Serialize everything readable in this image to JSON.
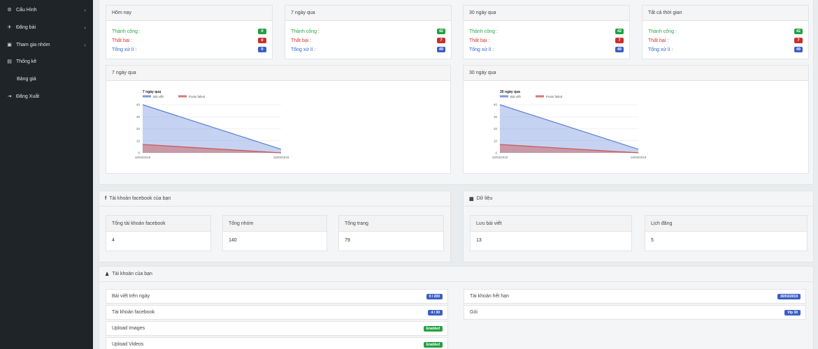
{
  "sidebar": {
    "items": [
      {
        "icon": "gear-icon",
        "label": "Cấu Hình",
        "glyph": "⚙",
        "chevron": "‹"
      },
      {
        "icon": "paper-plane-icon",
        "label": "Đăng bài",
        "glyph": "✈",
        "chevron": "‹"
      },
      {
        "icon": "group-icon",
        "label": "Tham gia nhóm",
        "glyph": "▣",
        "chevron": "‹"
      },
      {
        "icon": "chart-icon",
        "label": "Thống kê",
        "glyph": "▤",
        "chevron": ""
      },
      {
        "icon": "",
        "label": "Bảng giá",
        "glyph": "",
        "chevron": ""
      },
      {
        "icon": "sign-out-icon",
        "label": "Đăng Xuất",
        "glyph": "⇥",
        "chevron": ""
      }
    ]
  },
  "stats": [
    {
      "title": "Hôm nay",
      "success_label": "Thành công :",
      "success": "0",
      "fail_label": "Thất bại :",
      "fail": "0",
      "total_label": "Tổng xử lí :",
      "total": "0"
    },
    {
      "title": "7 ngày qua",
      "success_label": "Thành công :",
      "success": "42",
      "fail_label": "Thất bại :",
      "fail": "7",
      "total_label": "Tổng xử lí :",
      "total": "49"
    },
    {
      "title": "30 ngày qua",
      "success_label": "Thành công :",
      "success": "42",
      "fail_label": "Thất bại :",
      "fail": "7",
      "total_label": "Tổng xử lí :",
      "total": "49"
    },
    {
      "title": "Tất cả thời gian",
      "success_label": "Thành công :",
      "success": "42",
      "fail_label": "Thất bại :",
      "fail": "7",
      "total_label": "Tổng xử lí :",
      "total": "49"
    }
  ],
  "charts_panels": [
    {
      "title": "7 ngày qua"
    },
    {
      "title": "30 ngày qua"
    }
  ],
  "chart_data": [
    {
      "type": "area",
      "title": "7 ngày qua",
      "x": [
        "18/03/2019",
        "19/03/2019"
      ],
      "series": [
        {
          "name": "Bài viết",
          "values": [
            40,
            3
          ],
          "color": "#5b7fd6"
        },
        {
          "name": "Posts failed",
          "values": [
            7,
            0
          ],
          "color": "#c9554f"
        }
      ],
      "ylim": [
        0,
        40
      ],
      "yticks": [
        0,
        10,
        20,
        30,
        40
      ],
      "grid": true,
      "legend": "top"
    },
    {
      "type": "area",
      "title": "30 ngày qua",
      "x": [
        "18/03/2019",
        "19/03/2019"
      ],
      "series": [
        {
          "name": "Bài viết",
          "values": [
            40,
            3
          ],
          "color": "#5b7fd6"
        },
        {
          "name": "Posts failed",
          "values": [
            7,
            0
          ],
          "color": "#c9554f"
        }
      ],
      "ylim": [
        0,
        40
      ],
      "yticks": [
        0,
        10,
        20,
        30,
        40
      ],
      "grid": true,
      "legend": "top"
    }
  ],
  "facebook": {
    "icon": "facebook-icon",
    "glyph": "f",
    "title": "Tài khoản facebook của bạn",
    "boxes": [
      {
        "label": "Tổng tài khoản facebook",
        "value": "4"
      },
      {
        "label": "Tổng nhóm",
        "value": "140"
      },
      {
        "label": "Tổng trang",
        "value": "79"
      }
    ]
  },
  "data_panel": {
    "icon": "database-icon",
    "glyph": "▦",
    "title": "Dữ liệu",
    "boxes": [
      {
        "label": "Lưu bài viết",
        "value": "13"
      },
      {
        "label": "Lịch đăng",
        "value": "5"
      }
    ]
  },
  "account": {
    "icon": "user-icon",
    "glyph": "♟",
    "title": "Tài khoản của bạn",
    "left": [
      {
        "label": "Bài viết trên ngày",
        "badge": "0 / 200",
        "color": "#3a5ec7"
      },
      {
        "label": "Tài khoản facebook",
        "badge": "4 / 30",
        "color": "#3a5ec7"
      },
      {
        "label": "Upload Images",
        "badge": "Enabled",
        "color": "#22a043"
      },
      {
        "label": "Upload Videos",
        "badge": "Enabled",
        "color": "#22a043"
      }
    ],
    "right": [
      {
        "label": "Tài khoản hết hạn",
        "badge": "30/03/2019",
        "color": "#3a5ec7"
      },
      {
        "label": "Gói",
        "badge": "Vip 30",
        "color": "#3a5ec7"
      }
    ]
  }
}
